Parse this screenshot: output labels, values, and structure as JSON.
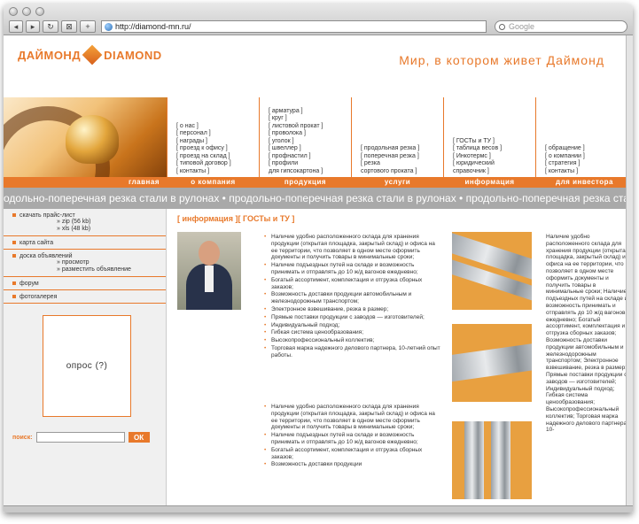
{
  "browser": {
    "url": "http://diamond-mn.ru/",
    "search_placeholder": "Google",
    "back": "◂",
    "forward": "▸",
    "reload": "↻",
    "bookmark": "⊠",
    "add": "+"
  },
  "site": {
    "logo_ru": "ДАЙМОНД",
    "logo_en": "DIAMOND",
    "slogan": "Мир, в котором живет Даймонд"
  },
  "nav": {
    "home": {
      "tab": "главная",
      "links": []
    },
    "columns": [
      {
        "tab": "о компания",
        "links": [
          "[ о нас ]",
          "[ персонал ]",
          "[ награды ]",
          "[ проезд к офису ]",
          "[ проезд на склад ]",
          "[ типовой договор ]",
          "[ контакты ]"
        ]
      },
      {
        "tab": "продукция",
        "links": [
          "[ арматура ]",
          "[ круг ]",
          "[ листовой прокат ]",
          "[ проволока ]",
          "[ уголок ]",
          "[ швеллер ]",
          "[ профнастил ]",
          "[ профили",
          "для гипсокартона ]"
        ]
      },
      {
        "tab": "услуги",
        "links": [
          "[ продольная резка ]",
          "[ поперечная резка ]",
          "[ резка",
          "сортового проката ]"
        ]
      },
      {
        "tab": "информация",
        "links": [
          "[ ГОСТы и ТУ ]",
          "[ таблица весов ]",
          "[ Инкотермс ]",
          "[ юридический",
          "справочник ]"
        ]
      },
      {
        "tab": "для инвестора",
        "links": [
          "[ обращение ]",
          "[ о компании ]",
          "[ стратегия ]",
          "[ контакты ]"
        ]
      }
    ]
  },
  "ticker": "одольно-поперечная резка стали в рулонах  •  продольно-поперечная резка стали в рулонах  •  продольно-поперечная резка стали в рулонах",
  "sidebar": {
    "price": "скачать прайс-лист",
    "price_zip": "» zip (56 kb)",
    "price_xls": "» xls (48 kb)",
    "sitemap": "карта сайта",
    "board": "доска объявлений",
    "board_view": "» просмотр",
    "board_post": "» разместить объявление",
    "forum": "форум",
    "photos": "фотогалерея",
    "poll": "опрос (?)",
    "search_label": "поиск:",
    "search_button": "ОК"
  },
  "content": {
    "breadcrumb": "[ информация ][ ГОСТы и ТУ ]",
    "bullets_1": [
      "Наличие удобно расположенного склада для хранения продукции (открытая площадка, закрытый склад) и офиса на ее территории, что позволяет в одном месте оформить документы и получить товары в минимальные сроки;",
      "Наличие подъездных путей на складе и возможность принимать и отправлять до 10 ж/д вагонов ежедневно;",
      "Богатый ассортимент, комплектация и отгрузка сборных заказов;",
      "Возможность доставки продукции автомобильным и железнодорожным транспортом;",
      "Электронное взвешивание, резка в размер;",
      "Прямые поставки продукции с заводов — изготовителей;",
      "Индивидуальный подход;",
      "Гибкая система ценообразования;",
      "Высокопрофессиональный коллектив;",
      "Торговая марка надежного делового партнера, 10-летний опыт работы."
    ],
    "bullets_2": [
      "Наличие удобно расположенного склада для хранения продукции (открытая площадка, закрытый склад) и офиса на ее территории, что позволяет в одном месте оформить документы и получить товары в минимальные сроки;",
      "Наличие подъездных путей на складе и возможность принимать и отправлять до 10 ж/д вагонов ежедневно;",
      "Богатый ассортимент, комплектация и отгрузка сборных заказов;",
      "Возможность доставки продукции"
    ],
    "right_text": "Наличие удобно расположенного склада для хранения продукции (открытая площадка, закрытый склад) и офиса на ее территории, что позволяет в одном месте оформить документы и получить товары в минимальные сроки; Наличие подъездных путей на складе и возможность принимать и отправлять до 10 ж/д вагонов ежедневно; Богатый ассортимент, комплектация и отгрузка сборных заказов; Возможность доставки продукции автомобильным и железнодорожным транспортом; Электронное взвешивание, резка в размер; Прямые поставки продукции с заводов — изготовителей; Индивидуальный подход; Гибкая система ценообразования; Высокопрофессиональный коллектив; Торговая марка надежного делового партнера, 10-"
  },
  "colors": {
    "accent": "#e8792b",
    "ticker_bg": "#a9a9a9",
    "sidebar_bg": "#f0f0f0"
  }
}
